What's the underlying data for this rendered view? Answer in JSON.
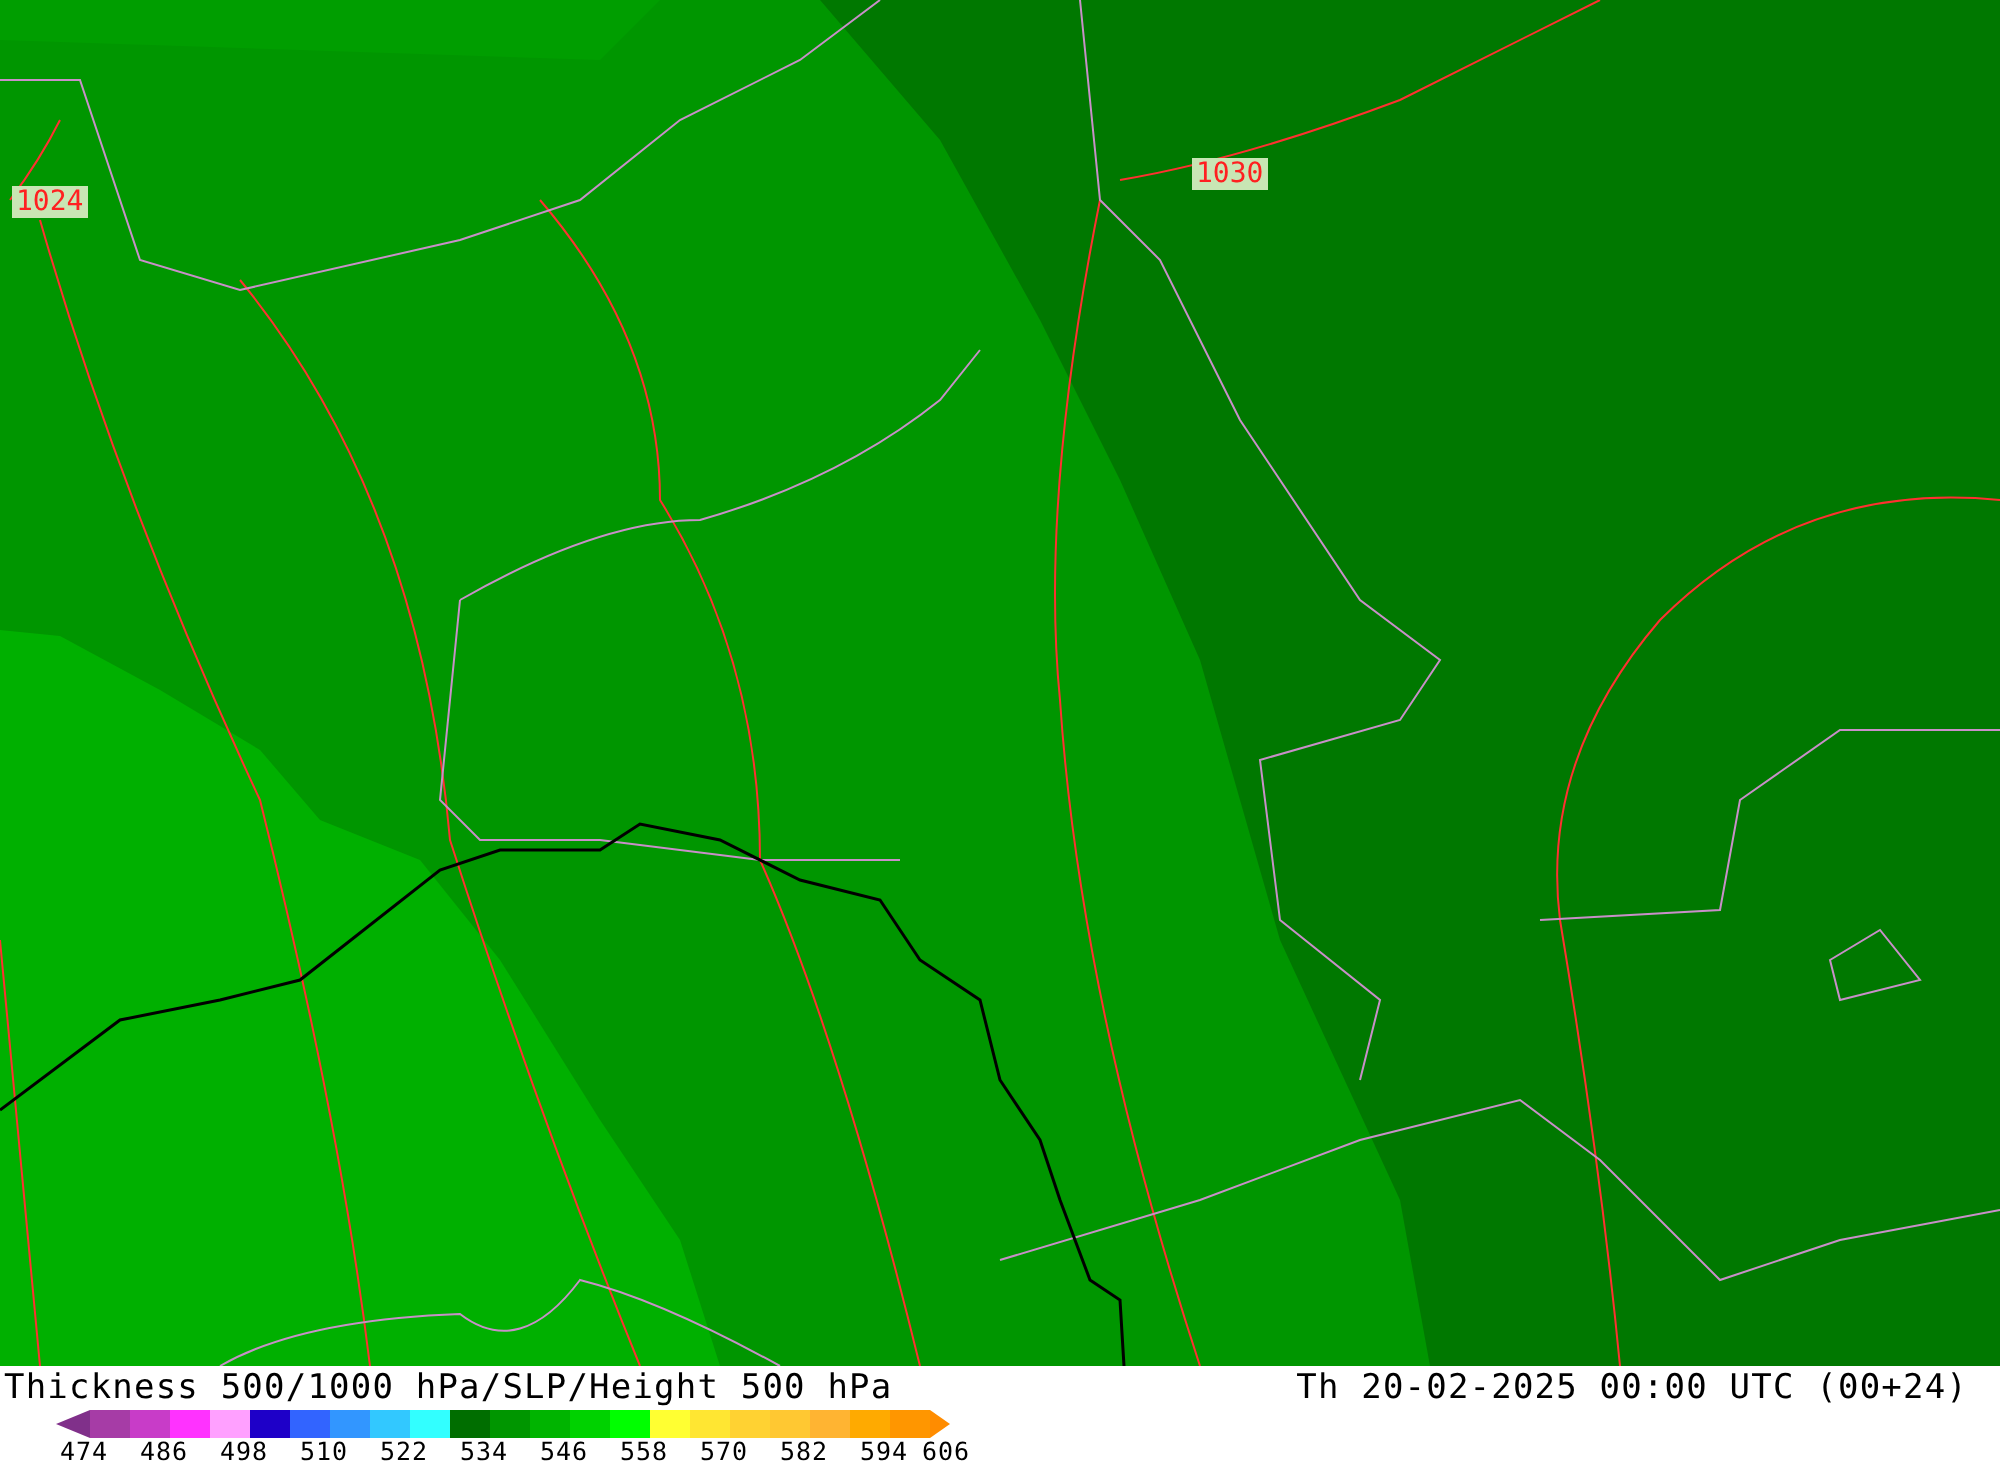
{
  "map": {
    "contour_labels": [
      {
        "text": "1024"
      },
      {
        "text": "1030"
      }
    ]
  },
  "title": "Thickness 500/1000 hPa/SLP/Height 500 hPa",
  "valid_time": "Th 20-02-2025 00:00 UTC (00+24)",
  "legend": {
    "bins": [
      {
        "kind": "arrow-left",
        "color": "#80308a"
      },
      {
        "kind": "swatch",
        "color": "#a63ca6"
      },
      {
        "kind": "swatch",
        "color": "#c83cc8"
      },
      {
        "kind": "swatch",
        "color": "#ff32ff"
      },
      {
        "kind": "swatch",
        "color": "#ffa0ff"
      },
      {
        "kind": "swatch",
        "color": "#1e00c8"
      },
      {
        "kind": "swatch",
        "color": "#3264ff"
      },
      {
        "kind": "swatch",
        "color": "#3296ff"
      },
      {
        "kind": "swatch",
        "color": "#32c8ff"
      },
      {
        "kind": "swatch",
        "color": "#32ffff"
      },
      {
        "kind": "swatch",
        "color": "#006e00"
      },
      {
        "kind": "swatch",
        "color": "#009600"
      },
      {
        "kind": "swatch",
        "color": "#00b400"
      },
      {
        "kind": "swatch",
        "color": "#00d200"
      },
      {
        "kind": "swatch",
        "color": "#00ff00"
      },
      {
        "kind": "swatch",
        "color": "#ffff32"
      },
      {
        "kind": "swatch",
        "color": "#ffe632"
      },
      {
        "kind": "swatch",
        "color": "#ffd232"
      },
      {
        "kind": "swatch",
        "color": "#ffc832"
      },
      {
        "kind": "swatch",
        "color": "#ffb432"
      },
      {
        "kind": "swatch",
        "color": "#ffaa00"
      },
      {
        "kind": "swatch",
        "color": "#ff9600"
      },
      {
        "kind": "arrow-right",
        "color": "#ff8c00"
      }
    ],
    "labels": [
      "474",
      "486",
      "498",
      "510",
      "522",
      "534",
      "546",
      "558",
      "570",
      "582",
      "594",
      "606"
    ]
  }
}
